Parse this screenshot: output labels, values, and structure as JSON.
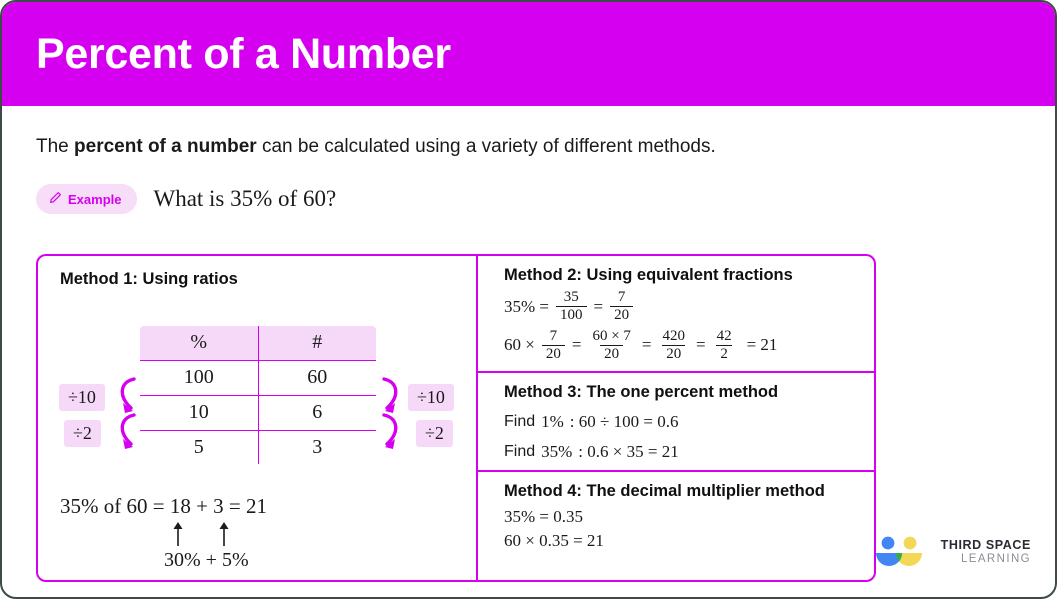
{
  "header": {
    "title": "Percent of a Number"
  },
  "intro": {
    "prefix": "The ",
    "bold": "percent of a number",
    "suffix": " can be calculated using a variety of different methods."
  },
  "example": {
    "badge_label": "Example",
    "badge_icon": "pencil-icon",
    "question": "What is 35% of 60?"
  },
  "method1": {
    "title": "Method 1: Using ratios",
    "table": {
      "headers": [
        "%",
        "#"
      ],
      "rows": [
        [
          "100",
          "60"
        ],
        [
          "10",
          "6"
        ],
        [
          "5",
          "3"
        ]
      ]
    },
    "operations": {
      "left_top": "÷10",
      "left_bottom": "÷2",
      "right_top": "÷10",
      "right_bottom": "÷2"
    },
    "conclusion_main": "35% of 60 = 18 + 3 = 21",
    "conclusion_sub": "30% + 5%"
  },
  "method2": {
    "title": "Method 2: Using equivalent fractions",
    "line1": {
      "lead": "35% =",
      "frac1": {
        "num": "35",
        "den": "100"
      },
      "eq1": "=",
      "frac2": {
        "num": "7",
        "den": "20"
      }
    },
    "line2": {
      "lead": "60 ×",
      "frac1": {
        "num": "7",
        "den": "20"
      },
      "eq1": "=",
      "frac2": {
        "num": "60 × 7",
        "den": "20"
      },
      "eq2": "=",
      "frac3": {
        "num": "420",
        "den": "20"
      },
      "eq3": "=",
      "frac4": {
        "num": "42",
        "den": "2"
      },
      "eq4": "= 21"
    }
  },
  "method3": {
    "title": "Method 3: The one percent method",
    "line1_label": "Find",
    "line1_percent": "1%",
    "line1_calc": ":  60 ÷ 100 = 0.6",
    "line2_label": "Find",
    "line2_percent": "35%",
    "line2_calc": ":  0.6 × 35 = 21"
  },
  "method4": {
    "title": "Method 4: The decimal multiplier method",
    "line1": "35% = 0.35",
    "line2": "60 × 0.35 = 21"
  },
  "logo": {
    "line1": "THIRD SPACE",
    "line2": "LEARNING",
    "colors": {
      "blue": "#4285f4",
      "yellow": "#f3d855",
      "green": "#34a853"
    }
  },
  "colors": {
    "brand_magenta": "#d600f0",
    "pill_pink": "#f7ddf8",
    "table_header_pink": "#f6d9f8",
    "frame_dark": "#3e4a45"
  }
}
